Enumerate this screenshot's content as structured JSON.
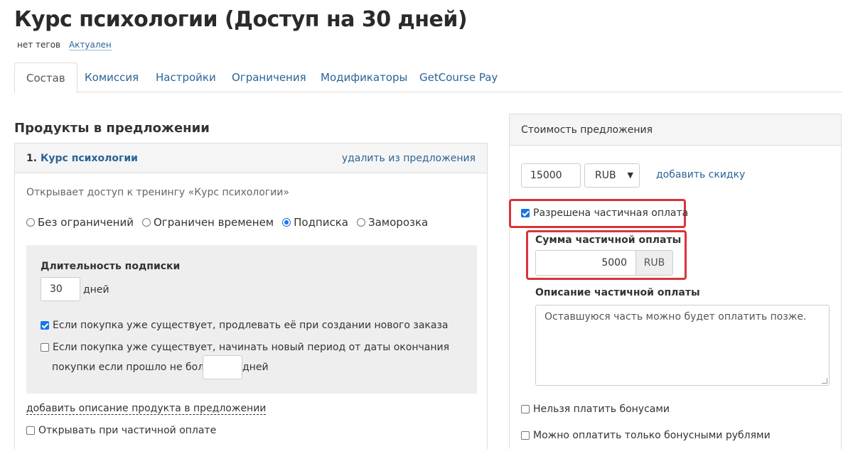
{
  "header": {
    "title": "Курс психологии (Доступ на 30 дней)",
    "tags_text": "нет тегов",
    "status_link": "Актуален"
  },
  "tabs": [
    {
      "label": "Состав",
      "active": true
    },
    {
      "label": "Комиссия"
    },
    {
      "label": "Настройки"
    },
    {
      "label": "Ограничения"
    },
    {
      "label": "Модификаторы"
    },
    {
      "label": "GetCourse Pay"
    }
  ],
  "products": {
    "section_title": "Продукты в предложении",
    "item": {
      "number": "1.",
      "name": "Курс психологии",
      "remove_label": "удалить из предложения",
      "description": "Открывает доступ к тренингу «Курс психологии»",
      "access_options": [
        {
          "label": "Без ограничений",
          "checked": false
        },
        {
          "label": "Ограничен временем",
          "checked": false
        },
        {
          "label": "Подписка",
          "checked": true
        },
        {
          "label": "Заморозка",
          "checked": false
        }
      ],
      "subscription": {
        "label": "Длительность подписки",
        "duration_value": "30",
        "duration_unit": "дней",
        "extend_label": "Если покупка уже существует, продлевать её при создании нового заказа",
        "extend_checked": true,
        "new_period_label_line1": "Если покупка уже существует, начинать новый период от даты окончания",
        "new_period_label_line2": "покупки если прошло не более",
        "new_period_value": "",
        "new_period_unit": "дней",
        "new_period_checked": false
      },
      "add_description_link": "добавить описание продукта в предложении",
      "open_on_partial_label": "Открывать при частичной оплате",
      "open_on_partial_checked": false
    }
  },
  "pricing": {
    "panel_title": "Стоимость предложения",
    "price_value": "15000",
    "currency": "RUB",
    "add_discount_link": "добавить скидку",
    "partial_allowed_label": "Разрешена частичная оплата",
    "partial_allowed_checked": true,
    "partial_amount_label": "Сумма частичной оплаты",
    "partial_amount_value": "5000",
    "partial_amount_currency": "RUB",
    "partial_description_label": "Описание частичной оплаты",
    "partial_description_value": "Оставшуюся часть можно будет оплатить позже.",
    "no_bonus_label": "Нельзя платить бонусами",
    "no_bonus_checked": false,
    "only_bonus_label": "Можно оплатить только бонусными рублями",
    "only_bonus_checked": false
  },
  "colors": {
    "link": "#2a6496",
    "highlight": "#d9343a",
    "checkbox_accent": "#1a73e8"
  }
}
